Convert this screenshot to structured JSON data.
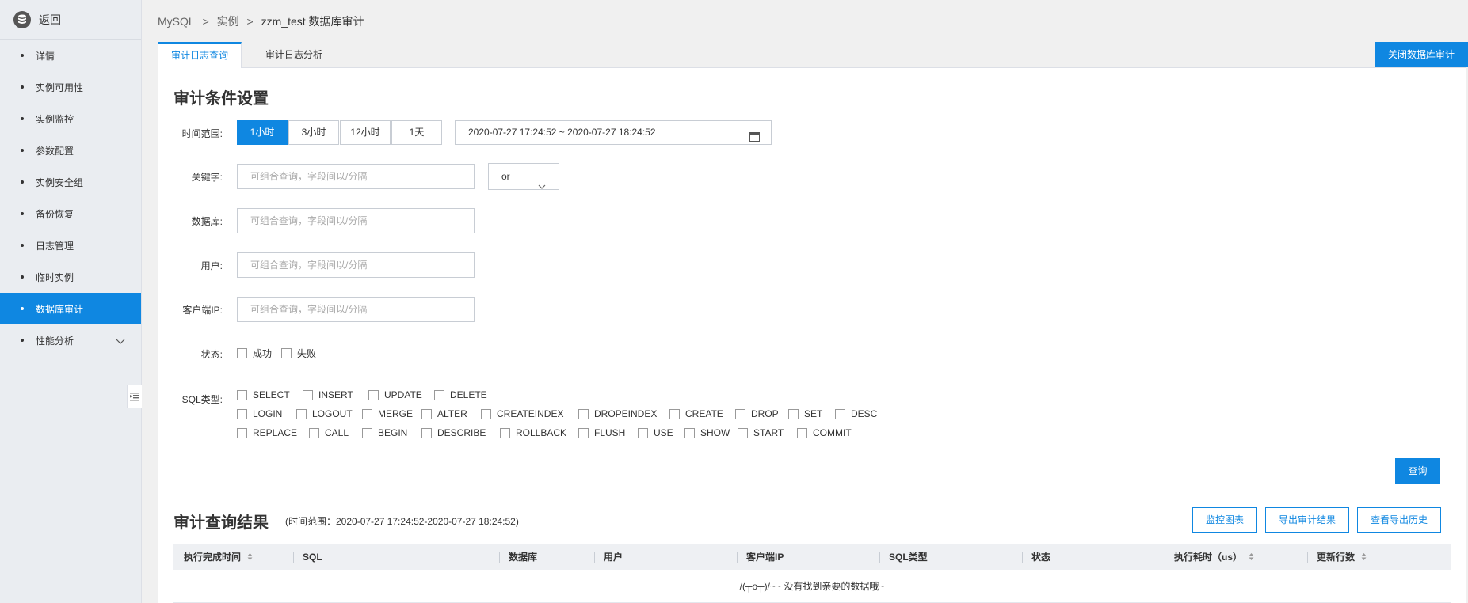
{
  "sidebar": {
    "back_label": "返回",
    "items": [
      {
        "label": "详情"
      },
      {
        "label": "实例可用性"
      },
      {
        "label": "实例监控"
      },
      {
        "label": "参数配置"
      },
      {
        "label": "实例安全组"
      },
      {
        "label": "备份恢复"
      },
      {
        "label": "日志管理"
      },
      {
        "label": "临时实例"
      },
      {
        "label": "数据库审计",
        "active": true
      },
      {
        "label": "性能分析",
        "expandable": true
      }
    ]
  },
  "breadcrumb": {
    "root": "MySQL",
    "sep": ">",
    "level2": "实例",
    "current": "zzm_test 数据库审计"
  },
  "tabs": [
    {
      "label": "审计日志查询",
      "active": true
    },
    {
      "label": "审计日志分析"
    }
  ],
  "header_action": {
    "label": "关闭数据库审计"
  },
  "conditions": {
    "title": "审计条件设置",
    "time_range": {
      "label": "时间范围:",
      "options": [
        "1小时",
        "3小时",
        "12小时",
        "1天"
      ],
      "selected": "1小时",
      "value": "2020-07-27 17:24:52 ~ 2020-07-27 18:24:52"
    },
    "keyword": {
      "label": "关键字:",
      "placeholder": "可组合查询，字段间以/分隔",
      "logic": "or"
    },
    "database": {
      "label": "数据库:",
      "placeholder": "可组合查询，字段间以/分隔"
    },
    "user": {
      "label": "用户:",
      "placeholder": "可组合查询，字段间以/分隔"
    },
    "client_ip": {
      "label": "客户端IP:",
      "placeholder": "可组合查询，字段间以/分隔"
    },
    "status": {
      "label": "状态:",
      "options": [
        "成功",
        "失败"
      ]
    },
    "sql_type": {
      "label": "SQL类型:",
      "rows": [
        [
          "SELECT",
          "INSERT",
          "UPDATE",
          "DELETE"
        ],
        [
          "LOGIN",
          "LOGOUT",
          "MERGE",
          "ALTER",
          "CREATEINDEX",
          "DROPEINDEX",
          "CREATE",
          "DROP",
          "SET",
          "DESC"
        ],
        [
          "REPLACE",
          "CALL",
          "BEGIN",
          "DESCRIBE",
          "ROLLBACK",
          "FLUSH",
          "USE",
          "SHOW",
          "START",
          "COMMIT"
        ]
      ]
    },
    "query_button": "查询"
  },
  "results": {
    "title": "审计查询结果",
    "range_text": "(时间范围：2020-07-27 17:24:52-2020-07-27 18:24:52)",
    "actions": [
      "监控图表",
      "导出审计结果",
      "查看导出历史"
    ],
    "columns": [
      {
        "label": "执行完成时间",
        "sortable": true
      },
      {
        "label": "SQL"
      },
      {
        "label": "数据库"
      },
      {
        "label": "用户"
      },
      {
        "label": "客户端IP"
      },
      {
        "label": "SQL类型"
      },
      {
        "label": "状态"
      },
      {
        "label": "执行耗时（us）",
        "sortable": true
      },
      {
        "label": "更新行数",
        "sortable": true
      }
    ],
    "empty_text": "/(┬o┬)/~~ 没有找到亲要的数据哦~"
  },
  "colors": {
    "accent": "#0f87e1",
    "sidebar_bg": "#eaedf1"
  }
}
